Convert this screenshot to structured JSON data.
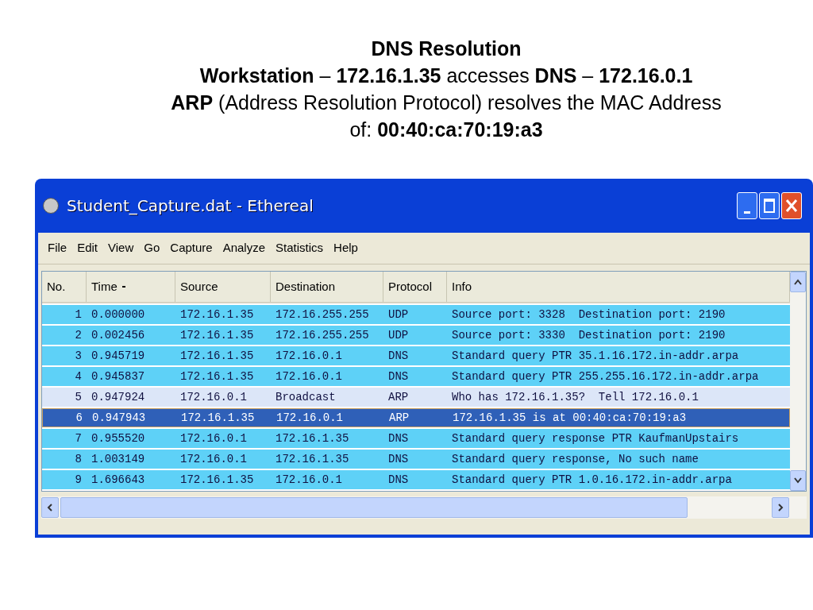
{
  "slide": {
    "title": "DNS Resolution",
    "lines": [
      "**Workstation** – **172.16.1.35** accesses **DNS** – **172.16.0.1**",
      "**ARP** (Address Resolution Protocol) resolves the MAC Address",
      "of: **00:40:ca:70:19:a3**"
    ]
  },
  "window": {
    "title": "Student_Capture.dat - Ethereal"
  },
  "menu": [
    "File",
    "Edit",
    "View",
    "Go",
    "Capture",
    "Analyze",
    "Statistics",
    "Help"
  ],
  "table": {
    "columns": [
      "No.",
      "Time",
      "Source",
      "Destination",
      "Protocol",
      "Info"
    ],
    "rows": [
      {
        "no": "1",
        "time": "0.000000",
        "source": "172.16.1.35",
        "destination": "172.16.255.255",
        "protocol": "UDP",
        "info": "Source port: 3328  Destination port: 2190",
        "color": "#5ed1f7",
        "selected": false
      },
      {
        "no": "2",
        "time": "0.002456",
        "source": "172.16.1.35",
        "destination": "172.16.255.255",
        "protocol": "UDP",
        "info": "Source port: 3330  Destination port: 2190",
        "color": "#5ed1f7",
        "selected": false
      },
      {
        "no": "3",
        "time": "0.945719",
        "source": "172.16.1.35",
        "destination": "172.16.0.1",
        "protocol": "DNS",
        "info": "Standard query PTR 35.1.16.172.in-addr.arpa",
        "color": "#5ed1f7",
        "selected": false
      },
      {
        "no": "4",
        "time": "0.945837",
        "source": "172.16.1.35",
        "destination": "172.16.0.1",
        "protocol": "DNS",
        "info": "Standard query PTR 255.255.16.172.in-addr.arpa",
        "color": "#5ed1f7",
        "selected": false
      },
      {
        "no": "5",
        "time": "0.947924",
        "source": "172.16.0.1",
        "destination": "Broadcast",
        "protocol": "ARP",
        "info": "Who has 172.16.1.35?  Tell 172.16.0.1",
        "color": "#dce6f8",
        "selected": false
      },
      {
        "no": "6",
        "time": "0.947943",
        "source": "172.16.1.35",
        "destination": "172.16.0.1",
        "protocol": "ARP",
        "info": "172.16.1.35 is at 00:40:ca:70:19:a3",
        "selected": true
      },
      {
        "no": "7",
        "time": "0.955520",
        "source": "172.16.0.1",
        "destination": "172.16.1.35",
        "protocol": "DNS",
        "info": "Standard query response PTR KaufmanUpstairs",
        "color": "#5ed1f7",
        "selected": false
      },
      {
        "no": "8",
        "time": "1.003149",
        "source": "172.16.0.1",
        "destination": "172.16.1.35",
        "protocol": "DNS",
        "info": "Standard query response, No such name",
        "color": "#5ed1f7",
        "selected": false
      },
      {
        "no": "9",
        "time": "1.696643",
        "source": "172.16.1.35",
        "destination": "172.16.0.1",
        "protocol": "DNS",
        "info": "Standard query PTR 1.0.16.172.in-addr.arpa",
        "color": "#5ed1f7",
        "selected": false
      }
    ]
  }
}
